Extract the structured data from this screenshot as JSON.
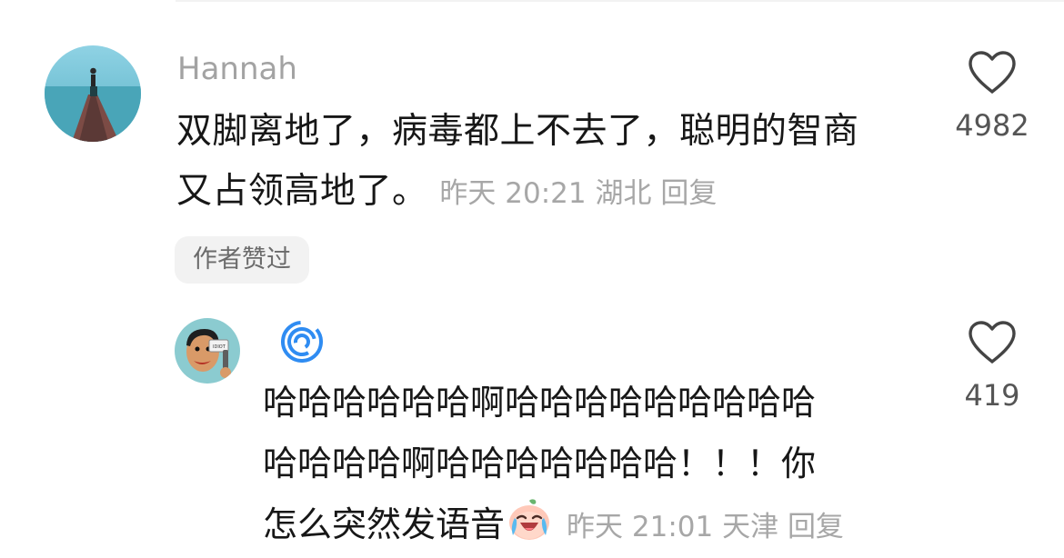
{
  "comment": {
    "username": "Hannah",
    "text_line1": "双脚离地了，病毒都上不去了，聪明的智商",
    "text_line2": "又占领高地了。",
    "time": "昨天 20:21",
    "location": "湖北",
    "reply_label": "回复",
    "likes": "4982",
    "author_badge": "作者赞过"
  },
  "reply": {
    "username_icon": "blue-swirl-icon",
    "text_line1": "哈哈哈哈哈哈啊哈哈哈哈哈哈哈哈哈",
    "text_line2": "哈哈哈哈啊哈哈哈哈哈哈哈！！！你",
    "text_line3": "怎么突然发语音",
    "emoji": "crying-laughing-emoji",
    "time": "昨天 21:01",
    "location": "天津",
    "reply_label": "回复",
    "likes": "419"
  },
  "colors": {
    "text": "#171717",
    "muted": "#a7a7a7",
    "badge_bg": "#f2f2f2",
    "swirl": "#2f8cf2"
  }
}
